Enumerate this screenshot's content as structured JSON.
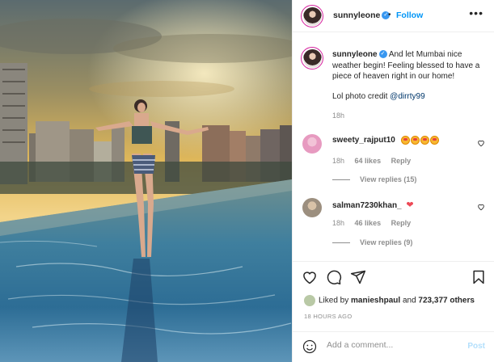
{
  "post": {
    "username": "sunnyleone",
    "follow_label": "Follow",
    "separator": "•",
    "more_label": "•••",
    "caption": {
      "username": "sunnyleone",
      "text": "And let Mumbai nice weather begin! Feeling blessed to have a piece of heaven right in our home!",
      "credit_prefix": "Lol photo credit",
      "credit_mention": "@dirrty99",
      "time": "18h"
    },
    "comments": [
      {
        "username": "sweety_rajput10",
        "emoji_count": 4,
        "time": "18h",
        "likes": "64 likes",
        "reply": "Reply",
        "view_replies": "View replies (15)"
      },
      {
        "username": "salman7230khan_",
        "text": "❤",
        "time": "18h",
        "likes": "46 likes",
        "reply": "Reply",
        "view_replies": "View replies (9)"
      }
    ],
    "liked_by_prefix": "Liked by",
    "liked_by_user": "manieshpaul",
    "liked_by_and": "and",
    "liked_by_others": "723,377 others",
    "time_ago": "18 HOURS AGO",
    "add_comment_placeholder": "Add a comment...",
    "post_label": "Post",
    "colors": {
      "accent": "#0095f6",
      "verified": "#3897f0",
      "muted": "#8e8e8e",
      "heart": "#ed4956",
      "post_disabled": "#b2dffc"
    }
  }
}
